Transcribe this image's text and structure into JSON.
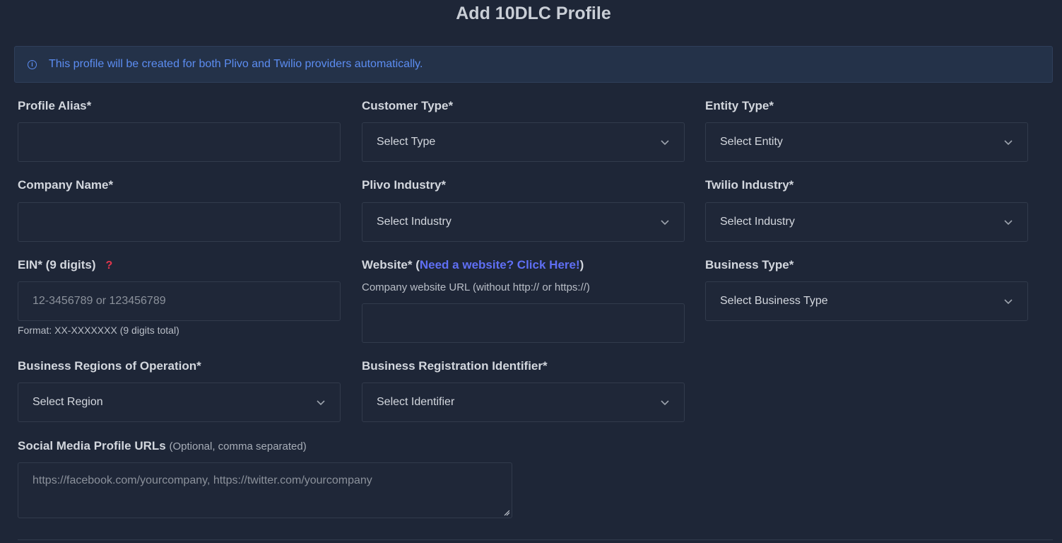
{
  "page": {
    "title": "Add 10DLC Profile",
    "info_text": "This profile will be created for both Plivo and Twilio providers automatically."
  },
  "fields": {
    "profile_alias": {
      "label": "Profile Alias*",
      "value": ""
    },
    "customer_type": {
      "label": "Customer Type*",
      "selected": "Select Type"
    },
    "entity_type": {
      "label": "Entity Type*",
      "selected": "Select Entity"
    },
    "company_name": {
      "label": "Company Name*",
      "value": ""
    },
    "plivo_industry": {
      "label": "Plivo Industry*",
      "selected": "Select Industry"
    },
    "twilio_industry": {
      "label": "Twilio Industry*",
      "selected": "Select Industry"
    },
    "ein": {
      "label": "EIN* (9 digits)",
      "help": "?",
      "placeholder": "12-3456789 or 123456789",
      "hint": "Format: XX-XXXXXXX (9 digits total)"
    },
    "website": {
      "label_prefix": "Website* (",
      "link_text": "Need a website? Click Here!",
      "label_suffix": ")",
      "hint": "Company website URL (without http:// or https://)",
      "value": ""
    },
    "business_type": {
      "label": "Business Type*",
      "selected": "Select Business Type"
    },
    "business_regions": {
      "label": "Business Regions of Operation*",
      "selected": "Select Region"
    },
    "business_registration_identifier": {
      "label": "Business Registration Identifier*",
      "selected": "Select Identifier"
    },
    "social_media": {
      "label": "Social Media Profile URLs",
      "label_note": "(Optional, comma separated)",
      "placeholder": "https://facebook.com/yourcompany, https://twitter.com/yourcompany"
    }
  },
  "colors": {
    "background": "#1e2637",
    "info_text": "#5c8df2",
    "link": "#5f6ff5",
    "help_icon": "#e2364c"
  },
  "icons": {
    "info": "info-circle-icon",
    "dropdown": "chevron-down-icon",
    "help": "question-mark-icon"
  }
}
